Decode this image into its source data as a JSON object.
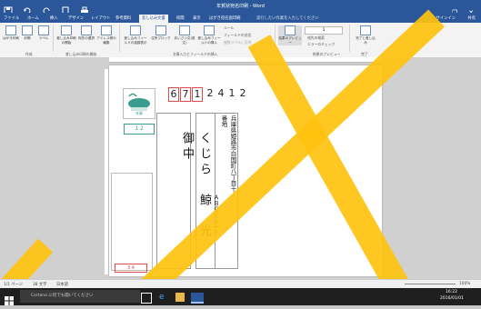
{
  "window": {
    "title": "年賀状宛名印刷 - Word"
  },
  "colors": {
    "accent": "#2b579a",
    "overlay": "#ffc20e",
    "zip_red": "#e04a4a"
  },
  "qat": {
    "icons": [
      "word-icon",
      "save-icon",
      "undo-icon",
      "redo-icon",
      "print-icon",
      "touch-icon"
    ]
  },
  "window_controls": {
    "minimize": "—",
    "restore": "❐",
    "close": "✕"
  },
  "tabs": [
    "ファイル",
    "ホーム",
    "挿入",
    "デザイン",
    "レイアウト",
    "参考資料",
    "差し込み文書",
    "校閲",
    "表示",
    "はがき宛名面印刷"
  ],
  "tell_me": "実行したい作業を入力してください",
  "signin": "サインイン",
  "share": "共有",
  "ribbon": {
    "create": [
      "はがき印刷",
      "封筒",
      "ラベル"
    ],
    "start": [
      "差し込み印刷の開始",
      "宛先の選択",
      "アドレス帳の編集"
    ],
    "insert": [
      "差し込みフィールドの強調表示",
      "住所ブロック",
      "あいさつ文(英文)",
      "差し込みフィールドの挿入"
    ],
    "rules": [
      "ルール",
      "フィールドの対応",
      "複数ラベルに反映"
    ],
    "preview_btn": "結果のプレビュー",
    "record": "1",
    "find": [
      "宛先の検索",
      "エラーのチェック"
    ],
    "finish": "完了と差し込み",
    "groups": [
      "作成",
      "差し込み印刷の開始",
      "文章入力とフィールドの挿入",
      "結果のプレビュー",
      "完了"
    ]
  },
  "doc": {
    "zipcode": [
      "6",
      "7",
      "1",
      "2",
      "4",
      "1",
      "2"
    ],
    "stamp_text": "年賀",
    "address": "兵庫県姫路市白国町八丁目十番地",
    "building": "ＡＢＣビル一Ｆ",
    "recipient_name": "くじら　鯨　光　御中",
    "sender_zip": "1 2",
    "sender_zip2": "3 4"
  },
  "status": {
    "page": "1/1 ページ",
    "words": "38 文字",
    "lang": "日本語",
    "zoom": "100%"
  },
  "taskbar": {
    "search": "Cortana に何でも聞いてください",
    "time": "16:22",
    "date": "2016/01/01"
  }
}
